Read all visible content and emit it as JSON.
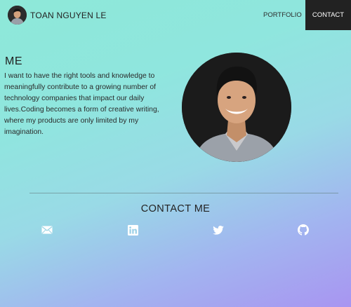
{
  "header": {
    "brand_name": "TOAN NGUYEN LE",
    "nav_items": [
      {
        "label": "PORTFOLIO"
      },
      {
        "label": "CONTACT"
      }
    ]
  },
  "about": {
    "heading": "ME",
    "text": "I want to have the right tools and knowledge to meaningfully contribute to a growing number of technology companies that impact our daily lives.Coding becomes a form of creative writing, where my products are only limited by my imagination."
  },
  "contact": {
    "heading": "CONTACT ME",
    "social_icons": [
      "mail-icon",
      "linkedin-icon",
      "twitter-icon",
      "github-icon"
    ]
  },
  "colors": {
    "contact_button_bg": "#222222",
    "icon_color": "#ffffff",
    "gradient_top": "#8ee8d8",
    "gradient_bottom": "#a895f1"
  }
}
